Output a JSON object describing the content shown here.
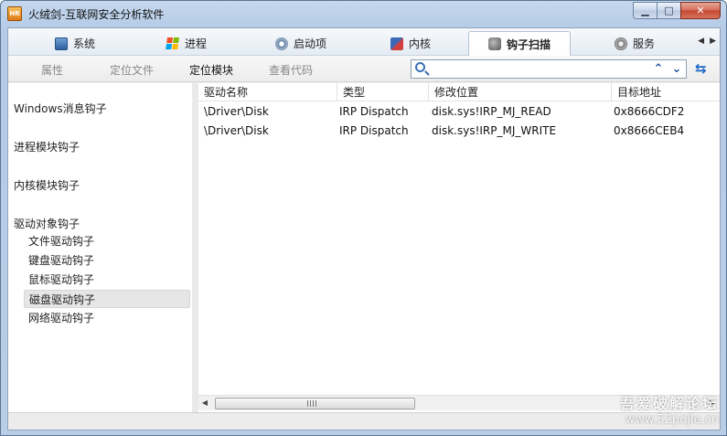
{
  "window": {
    "title": "火绒剑-互联网安全分析软件",
    "app_icon_text": "HR",
    "buttons": {
      "minimize": "▁",
      "maximize": "□",
      "close": "✕"
    }
  },
  "tabs": [
    {
      "label": "系统",
      "icon": "monitor-icon"
    },
    {
      "label": "进程",
      "icon": "windows-logo-icon"
    },
    {
      "label": "启动项",
      "icon": "startup-disc-icon"
    },
    {
      "label": "内核",
      "icon": "kernel-icon"
    },
    {
      "label": "钩子扫描",
      "icon": "hook-icon",
      "active": true
    },
    {
      "label": "服务",
      "icon": "gear-icon"
    }
  ],
  "tab_scroll": {
    "left": "◀",
    "right": "▶"
  },
  "toolbar": {
    "properties": "属性",
    "locate_file": "定位文件",
    "locate_module": "定位模块",
    "view_code": "查看代码",
    "search_placeholder": "",
    "search_value": "",
    "up": "⌃",
    "down": "⌄",
    "refresh": "⇆"
  },
  "sidebar": {
    "categories": [
      {
        "label": "Windows消息钩子"
      },
      {
        "label": "进程模块钩子"
      },
      {
        "label": "内核模块钩子"
      },
      {
        "label": "驱动对象钩子"
      }
    ],
    "driver_subitems": [
      {
        "label": "文件驱动钩子"
      },
      {
        "label": "键盘驱动钩子"
      },
      {
        "label": "鼠标驱动钩子"
      },
      {
        "label": "磁盘驱动钩子",
        "selected": true
      },
      {
        "label": "网络驱动钩子"
      }
    ]
  },
  "table": {
    "columns": [
      "驱动名称",
      "类型",
      "修改位置",
      "目标地址"
    ],
    "rows": [
      [
        "\\Driver\\Disk",
        "IRP Dispatch",
        "disk.sys!IRP_MJ_READ",
        "0x8666CDF2"
      ],
      [
        "\\Driver\\Disk",
        "IRP Dispatch",
        "disk.sys!IRP_MJ_WRITE",
        "0x8666CEB4"
      ]
    ]
  },
  "scrollbar": {
    "left": "◀",
    "right": "▶"
  },
  "watermark": {
    "line1": "吾爱破解论坛",
    "line2": "www.52pojie.cn"
  }
}
